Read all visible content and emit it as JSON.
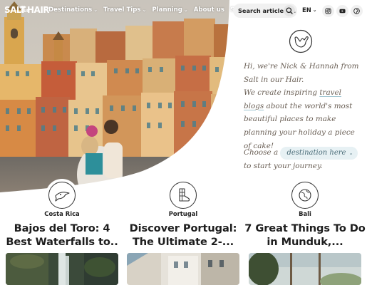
{
  "header": {
    "logo": {
      "word1": "SALT",
      "word2_line1": "IN",
      "word2_line2": "OUR",
      "word3": "HAIR"
    },
    "nav": [
      {
        "label": "Destinations",
        "has_dropdown": true
      },
      {
        "label": "Travel Tips",
        "has_dropdown": true
      },
      {
        "label": "Planning",
        "has_dropdown": true
      },
      {
        "label": "About us",
        "has_dropdown": false
      },
      {
        "label": "Shop",
        "has_dropdown": false,
        "icon": "cart-icon"
      }
    ],
    "search": {
      "placeholder": "Search articles ...",
      "icon": "search-icon"
    },
    "language": {
      "value": "EN"
    },
    "social": [
      "instagram-icon",
      "youtube-icon",
      "pinterest-icon"
    ]
  },
  "intro": {
    "icon": "shaka-hand-icon",
    "line1": "Hi, we're Nick & Hannah from Salt in our Hair.",
    "line2_pre": "We create inspiring ",
    "line2_link": "travel blogs",
    "line2_post": " about the world's most beautiful places to make planning your holiday a piece of cake!",
    "choose_pre": "Choose a",
    "choose_select": "destination here",
    "choose_post": "to start your journey."
  },
  "cards": [
    {
      "location": "Costa Rica",
      "title": "Bajos del Toro: 4 Best Waterfalls to..",
      "icon": "toucan-icon"
    },
    {
      "location": "Portugal",
      "title": "Discover Portugal: The Ultimate 2-...",
      "icon": "tiled-boot-icon"
    },
    {
      "location": "Bali",
      "title": "7 Great Things To Do in Munduk,...",
      "icon": "globe-leaf-icon"
    }
  ],
  "colors": {
    "intro_text": "#6a5f55",
    "select_bg": "#e7f1f4",
    "title_text": "#1e1e1e"
  }
}
